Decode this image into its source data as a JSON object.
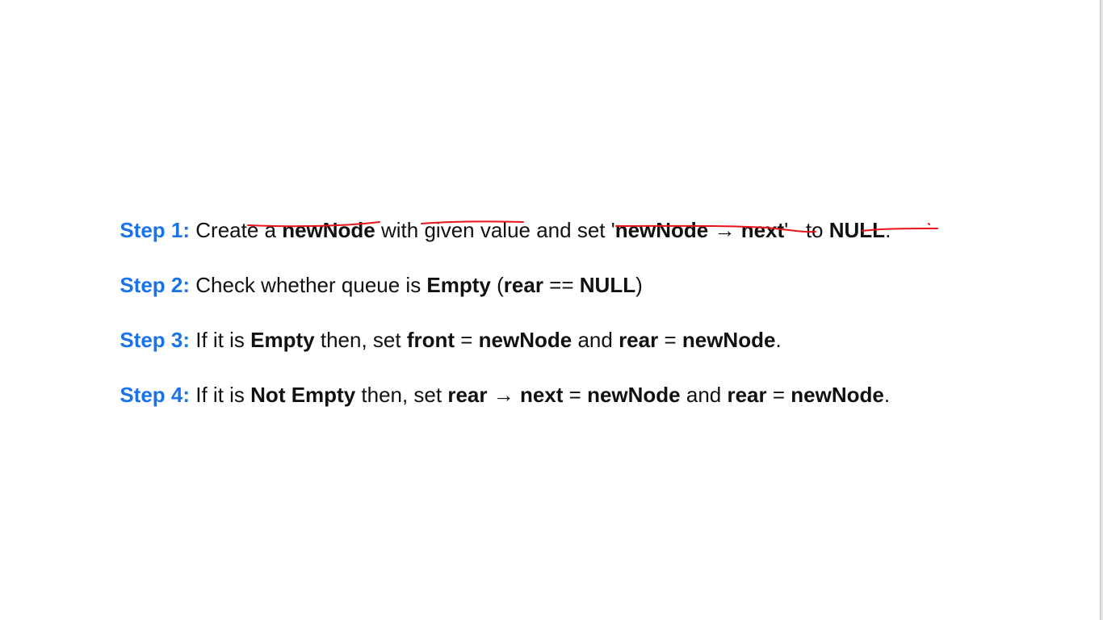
{
  "steps": [
    {
      "label": "Step 1:",
      "parts": [
        {
          "text": " Create a ",
          "bold": false
        },
        {
          "text": "newNode",
          "bold": true
        },
        {
          "text": " with given value and set '",
          "bold": false
        },
        {
          "text": "newNode → next",
          "bold": true
        },
        {
          "text": "'   to ",
          "bold": false
        },
        {
          "text": "NULL",
          "bold": true
        },
        {
          "text": ".",
          "bold": false
        }
      ]
    },
    {
      "label": "Step 2:",
      "parts": [
        {
          "text": " Check whether queue is ",
          "bold": false
        },
        {
          "text": "Empty",
          "bold": true
        },
        {
          "text": " (",
          "bold": false
        },
        {
          "text": "rear",
          "bold": true
        },
        {
          "text": " == ",
          "bold": false
        },
        {
          "text": "NULL",
          "bold": true
        },
        {
          "text": ")",
          "bold": false
        }
      ]
    },
    {
      "label": "Step 3:",
      "parts": [
        {
          "text": " If it is ",
          "bold": false
        },
        {
          "text": "Empty",
          "bold": true
        },
        {
          "text": " then, set ",
          "bold": false
        },
        {
          "text": "front",
          "bold": true
        },
        {
          "text": " = ",
          "bold": false
        },
        {
          "text": "newNode",
          "bold": true
        },
        {
          "text": " and ",
          "bold": false
        },
        {
          "text": "rear",
          "bold": true
        },
        {
          "text": " = ",
          "bold": false
        },
        {
          "text": "newNode",
          "bold": true
        },
        {
          "text": ".",
          "bold": false
        }
      ]
    },
    {
      "label": "Step 4:",
      "parts": [
        {
          "text": " If it is ",
          "bold": false
        },
        {
          "text": "Not Empty",
          "bold": true
        },
        {
          "text": " then, set ",
          "bold": false
        },
        {
          "text": "rear → next",
          "bold": true
        },
        {
          "text": " = ",
          "bold": false
        },
        {
          "text": "newNode",
          "bold": true
        },
        {
          "text": " and ",
          "bold": false
        },
        {
          "text": "rear",
          "bold": true
        },
        {
          "text": " = ",
          "bold": false
        },
        {
          "text": "newNode",
          "bold": true
        },
        {
          "text": ".",
          "bold": false
        }
      ]
    }
  ],
  "colors": {
    "step_label": "#1a73e8",
    "body_text": "#111111",
    "annotation": "#e8141b",
    "background": "#ffffff"
  }
}
